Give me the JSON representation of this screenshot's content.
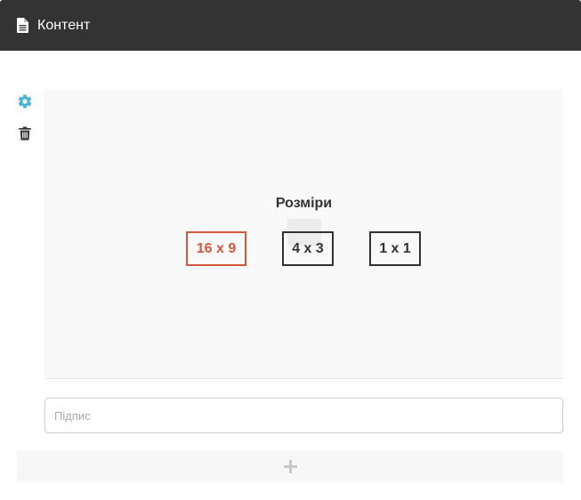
{
  "header": {
    "title": "Контент",
    "icon": "document-icon"
  },
  "tools": {
    "settings_icon": "gear-icon",
    "delete_icon": "trash-icon",
    "settings_color": "#4ab4d8"
  },
  "media": {
    "sizes_title": "Розміри",
    "sizes": [
      {
        "label": "16 x 9",
        "selected": true
      },
      {
        "label": "4 x 3",
        "selected": false
      },
      {
        "label": "1 x 1",
        "selected": false
      }
    ],
    "accent_color": "#d4583b"
  },
  "caption": {
    "placeholder": "Підпис",
    "value": ""
  },
  "add": {
    "icon": "plus-icon"
  }
}
